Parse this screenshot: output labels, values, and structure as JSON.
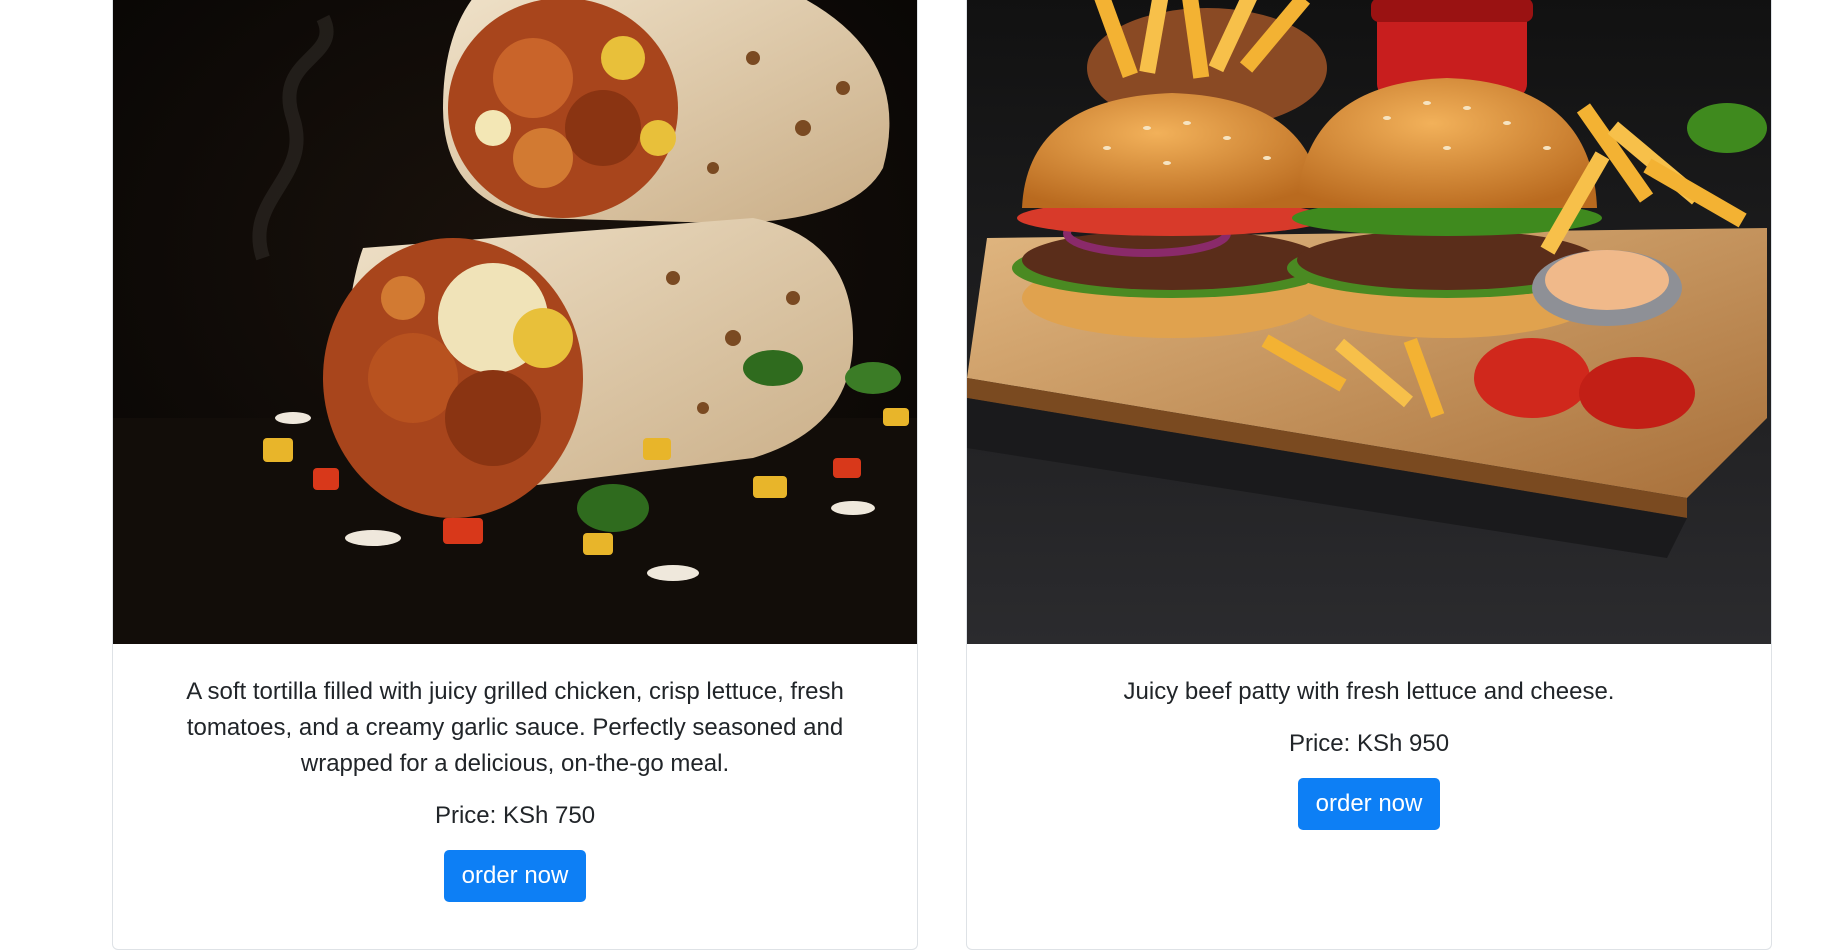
{
  "cards": [
    {
      "image_alt": "Chicken wrap",
      "description": "A soft tortilla filled with juicy grilled chicken, crisp lettuce, fresh tomatoes, and a creamy garlic sauce. Perfectly seasoned and wrapped for a delicious, on-the-go meal.",
      "price": "Price: KSh 750",
      "button_label": "order now"
    },
    {
      "image_alt": "Beef burger with fries",
      "description": "Juicy beef patty with fresh lettuce and cheese.",
      "price": "Price: KSh 950",
      "button_label": "order now"
    }
  ],
  "colors": {
    "button": "#0d7ff5",
    "button_text": "#ffffff",
    "card_border": "#dee2e6",
    "text": "#212529"
  }
}
